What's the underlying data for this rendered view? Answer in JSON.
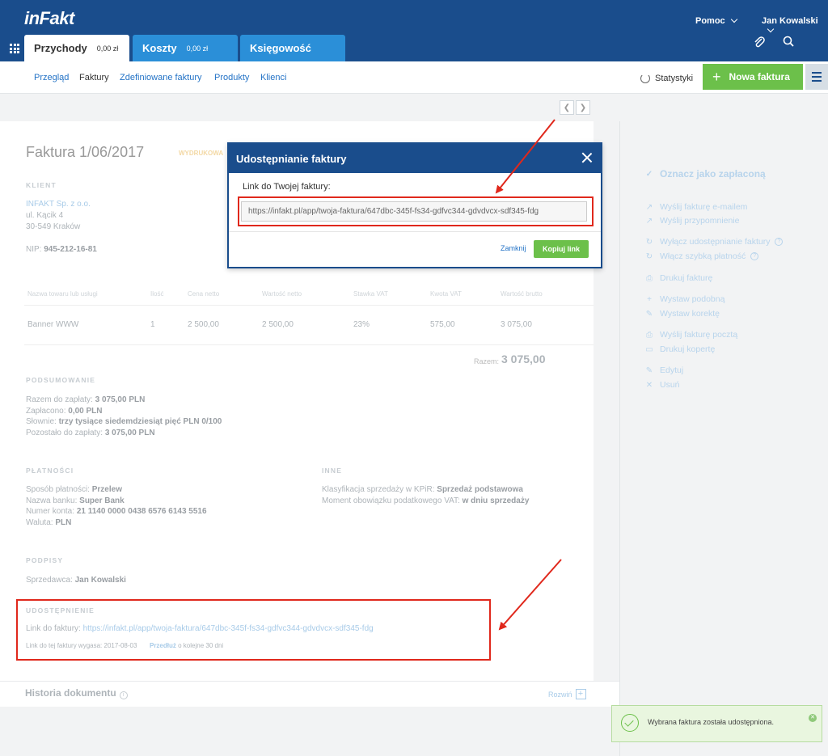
{
  "header": {
    "logo": "inFakt",
    "help": "Pomoc",
    "user": "Jan Kowalski",
    "tabs": [
      {
        "label": "Przychody",
        "amount": "0,00 zł"
      },
      {
        "label": "Koszty",
        "amount": "0,00 zł"
      },
      {
        "label": "Księgowość"
      }
    ]
  },
  "subnav": {
    "links": [
      "Przegląd",
      "Faktury",
      "Zdefiniowane faktury",
      "Produkty",
      "Klienci"
    ],
    "stats": "Statystyki",
    "new_invoice": "Nowa faktura"
  },
  "invoice": {
    "title": "Faktura 1/06/2017",
    "badge": "WYDRUKOWA",
    "client_label": "KLIENT",
    "client_name": "INFAKT Sp. z o.o.",
    "client_street": "ul. Kącik 4",
    "client_city": "30-549 Kraków",
    "nip_label": "NIP:",
    "nip_value": "945-212-16-81",
    "table_headers": [
      "Nazwa towaru lub usługi",
      "Ilość",
      "Cena netto",
      "Wartość netto",
      "Stawka VAT",
      "Kwota VAT",
      "Wartość brutto"
    ],
    "row": [
      "Banner WWW",
      "1",
      "2 500,00",
      "2 500,00",
      "23%",
      "575,00",
      "3 075,00"
    ],
    "total_label": "Razem:",
    "total_value": "3 075,00"
  },
  "summary": {
    "label": "PODSUMOWANIE",
    "lines": [
      {
        "k": "Razem do zapłaty:",
        "v": "3 075,00 PLN"
      },
      {
        "k": "Zapłacono:",
        "v": "0,00 PLN"
      },
      {
        "k": "Słownie:",
        "v": "trzy tysiące siedemdziesiąt pięć PLN 0/100"
      },
      {
        "k": "Pozostało do zapłaty:",
        "v": "3 075,00 PLN"
      }
    ]
  },
  "payments": {
    "label": "PŁATNOŚCI",
    "lines": [
      {
        "k": "Sposób płatności:",
        "v": "Przelew"
      },
      {
        "k": "Nazwa banku:",
        "v": "Super Bank"
      },
      {
        "k": "Numer konta:",
        "v": "21 1140 0000 0438 6576 6143 5516"
      },
      {
        "k": "Waluta:",
        "v": "PLN"
      }
    ]
  },
  "other": {
    "label": "INNE",
    "lines": [
      {
        "k": "Klasyfikacja sprzedaży w KPiR:",
        "v": "Sprzedaż podstawowa"
      },
      {
        "k": "Moment obowiązku podatkowego VAT:",
        "v": "w dniu sprzedaży"
      }
    ]
  },
  "signatures": {
    "label": "PODPISY",
    "k": "Sprzedawca:",
    "v": "Jan Kowalski"
  },
  "sharing": {
    "label": "UDOSTĘPNIENIE",
    "link_label": "Link do faktury:",
    "link": "https://infakt.pl/app/twoja-faktura/647dbc-345f-fs34-gdfvc344-gdvdvcx-sdf345-fdg",
    "expiry": "Link do tej faktury wygasa: 2017-08-03",
    "extend": "Przedłuż",
    "extend_rest": "o kolejne 30 dni"
  },
  "history": {
    "title": "Historia dokumentu",
    "expand": "Rozwiń"
  },
  "side_actions": [
    {
      "label": "Oznacz jako zapłaconą",
      "icon": "✓"
    },
    {
      "label": "Wyślij fakturę e-mailem",
      "icon": "↗"
    },
    {
      "label": "Wyślij przypomnienie",
      "icon": "↗"
    },
    {
      "label": "Wyłącz udostępnianie faktury",
      "icon": "↻"
    },
    {
      "label": "Włącz szybką płatność",
      "icon": "↻"
    },
    {
      "label": "Drukuj fakturę",
      "icon": "⎙"
    },
    {
      "label": "Wystaw podobną",
      "icon": "+"
    },
    {
      "label": "Wystaw korektę",
      "icon": "✎"
    },
    {
      "label": "Wyślij fakturę pocztą",
      "icon": "⎙"
    },
    {
      "label": "Drukuj kopertę",
      "icon": "▭"
    },
    {
      "label": "Edytuj",
      "icon": "✎"
    },
    {
      "label": "Usuń",
      "icon": "✕"
    }
  ],
  "modal": {
    "title": "Udostępnianie faktury",
    "label": "Link do Twojej faktury:",
    "link": "https://infakt.pl/app/twoja-faktura/647dbc-345f-fs34-gdfvc344-gdvdvcx-sdf345-fdg",
    "cancel": "Zamknij",
    "copy": "Kopiuj link"
  },
  "toast": {
    "message": "Wybrana faktura została udostępniona."
  },
  "colors": {
    "header": "#1a4d8c",
    "tab_blue": "#2b8fd8",
    "green": "#6cc04a",
    "annotation_red": "#e0281c"
  }
}
